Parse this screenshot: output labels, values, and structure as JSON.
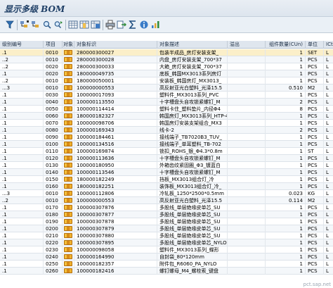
{
  "window": {
    "title": "显示多级 BOM"
  },
  "toolbar": {
    "icons": [
      "filter-icon",
      "expand-icon",
      "collapse-icon",
      "find-icon",
      "find-next-icon",
      "choose-layout-icon",
      "change-layout-icon",
      "save-layout-icon",
      "print-icon",
      "export-icon",
      "sum-icon",
      "details-icon",
      "graphic-icon"
    ]
  },
  "columns": [
    "级别编号",
    "项目",
    "对象",
    "对象标识",
    "对象描述",
    "溢出",
    "组件数量(CUn)",
    "单位",
    "ICt"
  ],
  "rows": [
    {
      "level": ".1",
      "item": "0010",
      "id": "280000300027",
      "desc": "包装半成品_房灯安装支架_",
      "overflow": "",
      "qty": "1",
      "unit": "SET",
      "ict": "L"
    },
    {
      "level": "..2",
      "item": "0010",
      "id": "280000300028",
      "desc": "内盘_房灯安装支架_700*37",
      "overflow": "",
      "qty": "1",
      "unit": "PCS",
      "ict": "L"
    },
    {
      "level": "..2",
      "item": "0020",
      "id": "280000300033",
      "desc": "大箱_房灯安装支架_700*37",
      "overflow": "",
      "qty": "1",
      "unit": "PCS",
      "ict": "L"
    },
    {
      "level": ".1",
      "item": "0020",
      "id": "180000049735",
      "desc": "底板_韩国MX3013系列房灯",
      "overflow": "",
      "qty": "1",
      "unit": "PCS",
      "ict": "L"
    },
    {
      "level": "..2",
      "item": "0010",
      "id": "180000050001",
      "desc": "安装板_韩国房灯_MX3013_",
      "overflow": "",
      "qty": "1",
      "unit": "PCS",
      "ict": "L"
    },
    {
      "level": "...3",
      "item": "0010",
      "id": "100000000553",
      "desc": "高反射亚光白塑料_光泽15.5",
      "overflow": "",
      "qty": "0.510",
      "unit": "M2",
      "ict": "L"
    },
    {
      "level": ".1",
      "item": "0030",
      "id": "100000017093",
      "desc": "塑料件_MX3013系列_PVC",
      "overflow": "",
      "qty": "1",
      "unit": "PCS",
      "ict": "L"
    },
    {
      "level": ".1",
      "item": "0040",
      "id": "100000113550",
      "desc": "十字槽盘头自攻锁紧螺钉_M",
      "overflow": "",
      "qty": "2",
      "unit": "PCS",
      "ict": "L"
    },
    {
      "level": ".1",
      "item": "0050",
      "id": "100000114414",
      "desc": "塑料卡住_塑料垫片_内径Φ4",
      "overflow": "",
      "qty": "8",
      "unit": "PCS",
      "ict": "L"
    },
    {
      "level": ".1",
      "item": "0060",
      "id": "180000182327",
      "desc": "韩国房灯_MX3013系列_HTP-4",
      "overflow": "",
      "qty": "1",
      "unit": "PCS",
      "ict": "L"
    },
    {
      "level": ".1",
      "item": "0070",
      "id": "100000098706",
      "desc": "韩国房灯安装支架组合_MX3",
      "overflow": "",
      "qty": "1",
      "unit": "PCS",
      "ict": "L"
    },
    {
      "level": ".1",
      "item": "0080",
      "id": "100000169343",
      "desc": "线卡-2",
      "overflow": "",
      "qty": "2",
      "unit": "PCS",
      "ict": "L"
    },
    {
      "level": ".1",
      "item": "0090",
      "id": "100000184461",
      "desc": "接线端子_TB7020B3_TUV_",
      "overflow": "",
      "qty": "1",
      "unit": "PCS",
      "ict": "L"
    },
    {
      "level": ".1",
      "item": "0100",
      "id": "100000134516",
      "desc": "接线端子_单耳塑料_TB-702",
      "overflow": "",
      "qty": "1",
      "unit": "PCS",
      "ict": "L"
    },
    {
      "level": ".1",
      "item": "0110",
      "id": "100000169874",
      "desc": "锁扣_ROHS_银_Φ4.3*0.8m",
      "overflow": "",
      "qty": "1",
      "unit": "ST",
      "ict": "L"
    },
    {
      "level": ".1",
      "item": "0120",
      "id": "100000113636",
      "desc": "十字槽盘头自攻锁紧螺钉_M",
      "overflow": "",
      "qty": "1",
      "unit": "PCS",
      "ict": "L"
    },
    {
      "level": ".1",
      "item": "0130",
      "id": "100000180950",
      "desc": "外箱齿纹紧固圈_Φ3_镀蓝白",
      "overflow": "",
      "qty": "1",
      "unit": "PCS",
      "ict": "L"
    },
    {
      "level": ".1",
      "item": "0140",
      "id": "100000113546",
      "desc": "十字槽盘头自攻锁紧螺钉_M",
      "overflow": "",
      "qty": "1",
      "unit": "PCS",
      "ict": "L"
    },
    {
      "level": ".1",
      "item": "0150",
      "id": "180000182249",
      "desc": "挡板_MX3013组合灯_冷",
      "overflow": "",
      "qty": "1",
      "unit": "PCS",
      "ict": "L"
    },
    {
      "level": ".1",
      "item": "0160",
      "id": "180000182251",
      "desc": "装饰板_MX3013组合灯_冷_",
      "overflow": "",
      "qty": "1",
      "unit": "PCS",
      "ict": "L"
    },
    {
      "level": "...3",
      "item": "0010",
      "id": "100000112806",
      "desc": "冷轧板_1250*2500*0.5mm",
      "overflow": "",
      "qty": "0.023",
      "unit": "KG",
      "ict": "L"
    },
    {
      "level": "..2",
      "item": "0010",
      "id": "100000000553",
      "desc": "高反射亚光白塑料_光泽15.5",
      "overflow": "",
      "qty": "0.114",
      "unit": "M2",
      "ict": "L"
    },
    {
      "level": ".1",
      "item": "0170",
      "id": "100000307876",
      "desc": "多股线_单层绝缘皮单芯_SU",
      "overflow": "",
      "qty": "1",
      "unit": "PCS",
      "ict": "L"
    },
    {
      "level": ".1",
      "item": "0180",
      "id": "100000307877",
      "desc": "多股线_单层绝缘皮单芯_SU",
      "overflow": "",
      "qty": "1",
      "unit": "PCS",
      "ict": "L"
    },
    {
      "level": ".1",
      "item": "0190",
      "id": "100000307878",
      "desc": "多股线_单层绝缘皮单芯_SU",
      "overflow": "",
      "qty": "1",
      "unit": "PCS",
      "ict": "L"
    },
    {
      "level": ".1",
      "item": "0200",
      "id": "100000307879",
      "desc": "多股线_单层绝缘皮单芯_SU",
      "overflow": "",
      "qty": "1",
      "unit": "PCS",
      "ict": "L"
    },
    {
      "level": ".1",
      "item": "0210",
      "id": "100000307880",
      "desc": "多股线_单层绝缘皮单芯_SU",
      "overflow": "",
      "qty": "1",
      "unit": "PCS",
      "ict": "L"
    },
    {
      "level": ".1",
      "item": "0220",
      "id": "100000307895",
      "desc": "多股线_单层绝缘皮单芯_NYLO",
      "overflow": "",
      "qty": "1",
      "unit": "PCS",
      "ict": "L"
    },
    {
      "level": ".1",
      "item": "0230",
      "id": "100000098058",
      "desc": "塑料件_MX3013系列_蝶形",
      "overflow": "",
      "qty": "1",
      "unit": "PCS",
      "ict": "L"
    },
    {
      "level": ".1",
      "item": "0240",
      "id": "100000164990",
      "desc": "自封袋_80*120mm",
      "overflow": "",
      "qty": "1",
      "unit": "PCS",
      "ict": "L"
    },
    {
      "level": ".1",
      "item": "0250",
      "id": "100000182357",
      "desc": "附件包_R6060_PA_NYLO",
      "overflow": "",
      "qty": "1",
      "unit": "PCS",
      "ict": "L"
    },
    {
      "level": ".1",
      "item": "0260",
      "id": "100000182416",
      "desc": "螺钉螺母_M4_螺栓索_键盘",
      "overflow": "",
      "qty": "1",
      "unit": "PCS",
      "ict": "L"
    }
  ],
  "watermark": "pct.sap.net"
}
